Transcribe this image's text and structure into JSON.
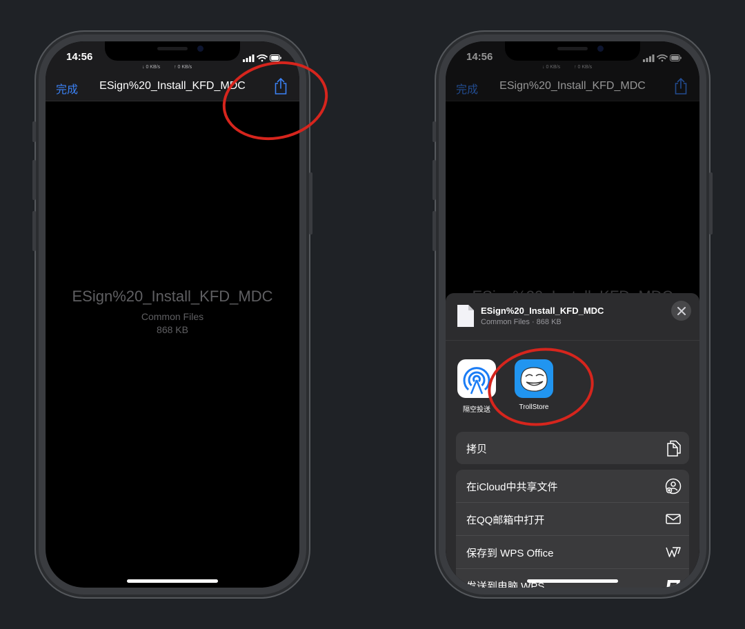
{
  "status": {
    "time": "14:56",
    "down_speed": "↓ 0 KB/s",
    "up_speed": "↑ 0 KB/s"
  },
  "nav": {
    "done": "完成",
    "title": "ESign%20_Install_KFD_MDC"
  },
  "preview": {
    "name": "ESign%20_Install_KFD_MDC",
    "category": "Common Files",
    "size": "868 KB"
  },
  "sheet": {
    "file_name": "ESign%20_Install_KFD_MDC",
    "file_meta": "Common Files · 868 KB",
    "apps": [
      {
        "label": "隔空投送",
        "icon": "airdrop-icon"
      },
      {
        "label": "TrollStore",
        "icon": "trollstore-icon"
      }
    ],
    "copy_label": "拷贝",
    "actions": [
      {
        "label": "在iCloud中共享文件",
        "icon": "icloud-share-icon"
      },
      {
        "label": "在QQ邮箱中打开",
        "icon": "envelope-icon"
      },
      {
        "label": "保存到 WPS Office",
        "icon": "wps-icon"
      },
      {
        "label": "发送到电脑 WPS",
        "icon": "send-to-pc-icon"
      }
    ]
  },
  "annotation_color": "#d6251d",
  "accent_color": "#3b82f6"
}
